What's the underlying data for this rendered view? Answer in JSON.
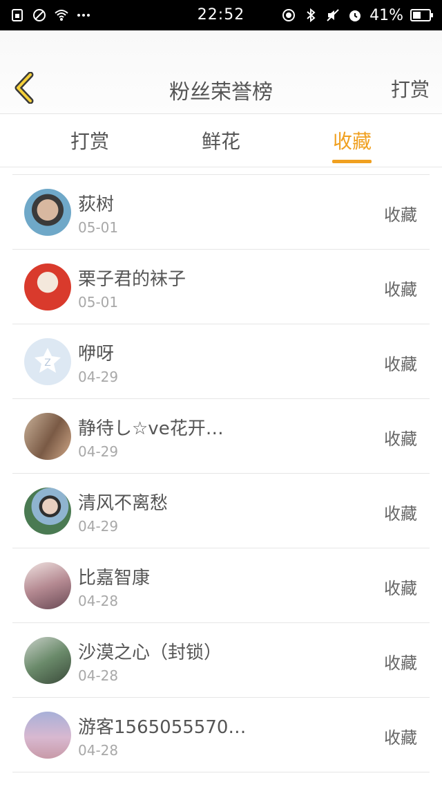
{
  "status_bar": {
    "time": "22:52",
    "battery": "41%",
    "left_icons": [
      "sim-icon",
      "no-disturb-icon",
      "wifi-icon",
      "more-dots-icon"
    ],
    "right_icons": [
      "location-icon",
      "bluetooth-icon",
      "mute-icon",
      "alarm-icon",
      "battery-icon"
    ]
  },
  "header": {
    "title": "粉丝荣誉榜",
    "right_action": "打赏",
    "back_icon": "chevron-left-icon",
    "accent_color": "#f0a020"
  },
  "tabs": [
    {
      "label": "打赏",
      "active": false
    },
    {
      "label": "鲜花",
      "active": false
    },
    {
      "label": "收藏",
      "active": true
    }
  ],
  "list": {
    "items": [
      {
        "name": "荻树",
        "date": "05-01",
        "action": "收藏",
        "avatar_color": "#6fa8c8"
      },
      {
        "name": "栗子君的袜子",
        "date": "05-01",
        "action": "收藏",
        "avatar_color": "#d93a2c"
      },
      {
        "name": "咿呀",
        "date": "04-29",
        "action": "收藏",
        "avatar_color": "#dde8f3"
      },
      {
        "name": "静待し☆ve花开…",
        "date": "04-29",
        "action": "收藏",
        "avatar_color": "#8a6a55"
      },
      {
        "name": "清风不离愁",
        "date": "04-29",
        "action": "收藏",
        "avatar_color": "#5a8a6a"
      },
      {
        "name": "比嘉智康",
        "date": "04-28",
        "action": "收藏",
        "avatar_color": "#c9a5a8"
      },
      {
        "name": "沙漠之心（封锁）",
        "date": "04-28",
        "action": "收藏",
        "avatar_color": "#7a9a7a"
      },
      {
        "name": "游客1565055570…",
        "date": "04-28",
        "action": "收藏",
        "avatar_color": "#b8a4c8"
      }
    ]
  }
}
